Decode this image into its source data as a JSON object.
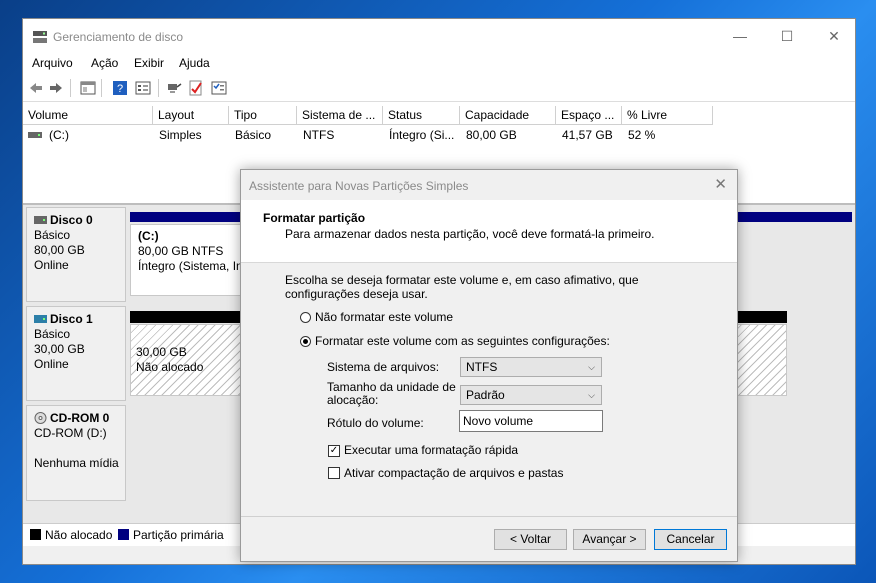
{
  "window": {
    "title": "Gerenciamento de disco",
    "minimize": "—",
    "maximize": "☐",
    "close": "✕"
  },
  "menu": [
    "Arquivo",
    "Ação",
    "Exibir",
    "Ajuda"
  ],
  "toolbar_icons": [
    "back-arrow-icon",
    "forward-arrow-icon",
    "properties-icon",
    "help-icon",
    "list-view-icon",
    "connect-icon",
    "check-icon",
    "settings-icon"
  ],
  "table": {
    "columns": [
      "Volume",
      "Layout",
      "Tipo",
      "Sistema de ...",
      "Status",
      "Capacidade",
      "Espaço ...",
      "% Livre"
    ],
    "rows": [
      {
        "volume": "(C:)",
        "layout": "Simples",
        "tipo": "Básico",
        "sistema": "NTFS",
        "status": "Íntegro (Si...",
        "capacidade": "80,00 GB",
        "espaco": "41,57 GB",
        "livre": "52 %"
      }
    ]
  },
  "disks": [
    {
      "name": "Disco 0",
      "type": "Básico",
      "size": "80,00 GB",
      "state": "Online",
      "partition": {
        "label": "(C:)",
        "size": "80,00 GB NTFS",
        "status": "Íntegro (Sistema, Ini"
      }
    },
    {
      "name": "Disco 1",
      "type": "Básico",
      "size": "30,00 GB",
      "state": "Online",
      "partition": {
        "size": "30,00 GB",
        "status": "Não alocado"
      }
    },
    {
      "name": "CD-ROM 0",
      "type": "CD-ROM (D:)",
      "state": "Nenhuma mídia"
    }
  ],
  "legend": {
    "unallocated": "Não alocado",
    "primary": "Partição primária"
  },
  "colors": {
    "primary": "#000080",
    "unallocated": "#000000",
    "accent": "#0078d7"
  },
  "dialog": {
    "title": "Assistente para Novas Partições Simples",
    "close": "✕",
    "heading": "Formatar partição",
    "subheading": "Para armazenar dados nesta partição, você deve formatá-la primeiro.",
    "intro": "Escolha se deseja formatar este volume e, em caso afimativo, que configurações deseja usar.",
    "opt_no_format": "Não formatar este volume",
    "opt_format": "Formatar este volume com as seguintes configurações:",
    "fs_label": "Sistema de arquivos:",
    "fs_value": "NTFS",
    "alloc_label_1": "Tamanho da unidade de",
    "alloc_label_2": "alocação:",
    "alloc_value": "Padrão",
    "vol_label": "Rótulo do volume:",
    "vol_value": "Novo volume",
    "quick_format": "Executar uma formatação rápida",
    "compression": "Ativar compactação de arquivos e pastas",
    "quick_checked": true,
    "compression_checked": false,
    "btn_back": "< Voltar",
    "btn_next": "Avançar >",
    "btn_cancel": "Cancelar"
  }
}
